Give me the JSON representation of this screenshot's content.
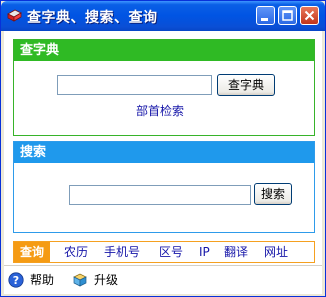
{
  "window": {
    "title": "查字典、搜索、查询"
  },
  "dictionary_panel": {
    "heading": "查字典",
    "input_value": "",
    "button_label": "查字典",
    "radical_link": "部首检索"
  },
  "search_panel": {
    "heading": "搜索",
    "input_value": "",
    "button_label": "搜索"
  },
  "query_bar": {
    "active_label": "查询",
    "links": [
      "农历",
      "手机号",
      "区号",
      "IP",
      "翻译",
      "网址"
    ]
  },
  "status_bar": {
    "help_label": "帮助",
    "upgrade_label": "升级"
  },
  "colors": {
    "title_bar": "#0054e3",
    "dictionary_accent": "#2fba24",
    "search_accent": "#1f99ec",
    "query_accent": "#f59b14",
    "link": "#1515a8"
  },
  "icons": {
    "app": "red-book-icon",
    "minimize": "minimize-icon",
    "maximize": "maximize-icon",
    "close": "close-icon",
    "help": "help-icon",
    "upgrade": "upgrade-box-icon"
  }
}
